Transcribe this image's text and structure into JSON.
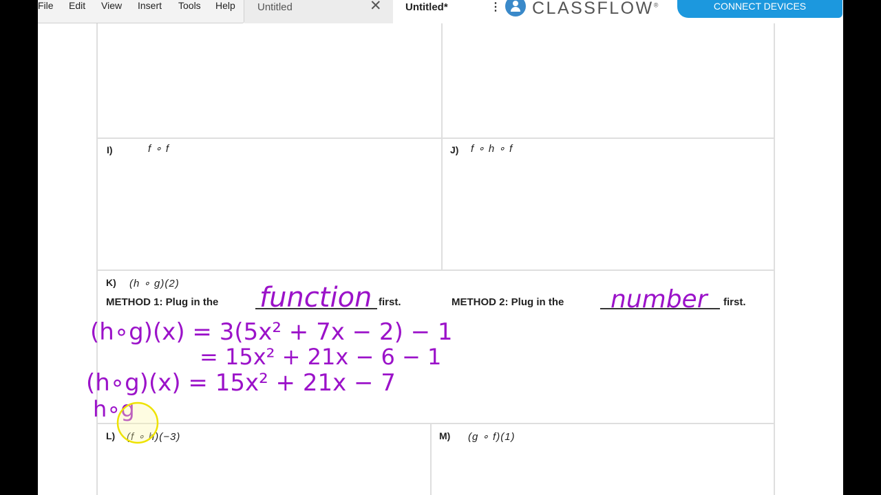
{
  "menu": [
    "File",
    "Edit",
    "View",
    "Insert",
    "Tools",
    "Help"
  ],
  "tabs": [
    {
      "label": "Untitled",
      "close": "✕"
    },
    {
      "label": "Untitled*",
      "more": "⋮"
    }
  ],
  "brand": {
    "name": "CLASSFLOW",
    "reg": "®"
  },
  "connect_button": "CONNECT DEVICES",
  "worksheet": {
    "I": {
      "label": "I)",
      "expr": "f ∘ f"
    },
    "J": {
      "label": "J)",
      "expr": "f ∘ h ∘ f"
    },
    "K": {
      "label": "K)",
      "expr": "(h ∘ g)(2)",
      "method1": "METHOD 1: Plug in the",
      "method1_end": "first.",
      "method2": "METHOD 2: Plug in the",
      "method2_end": "first."
    },
    "L": {
      "label": "L)",
      "expr": "(f ∘ h)(−3)"
    },
    "M": {
      "label": "M)",
      "expr": "(g ∘ f)(1)"
    }
  },
  "handwriting": {
    "blank1": "function",
    "blank2": "number",
    "line1": "(h∘g)(x) = 3(5x² + 7x − 2) − 1",
    "line2": "= 15x² + 21x − 6 − 1",
    "line3": "(h∘g)(x) = 15x² + 21x − 7",
    "line4": "h∘g"
  },
  "colors": {
    "ink": "#9b12c9",
    "highlight": "#f0e000",
    "brand_blue": "#1c98de"
  }
}
